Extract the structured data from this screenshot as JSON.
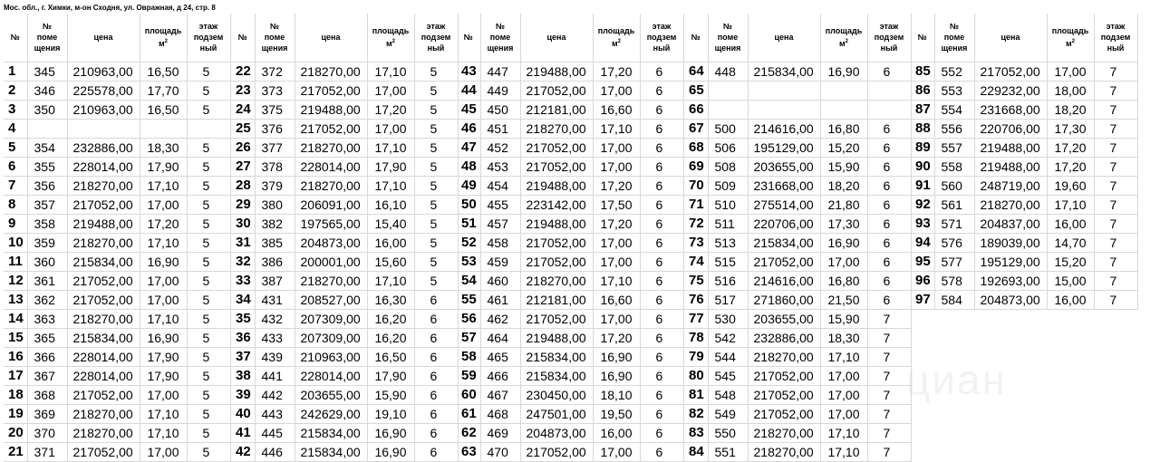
{
  "title": "Мос. обл., г. Химки, м-он Сходня, ул. Овражная, д 24, стр. 8",
  "headers": {
    "num": "№",
    "room_line1": "№",
    "room_line2": "поме",
    "room_line3": "щения",
    "price": "цена",
    "area": "площадь",
    "area_unit": "м",
    "area_sup": "2",
    "floor_line1": "этаж",
    "floor_line2": "подзем",
    "floor_line3": "ный"
  },
  "watermark": "циан",
  "blocks": [
    {
      "rows": [
        [
          "1",
          "345",
          "210963,00",
          "16,50",
          "5"
        ],
        [
          "2",
          "346",
          "225578,00",
          "17,70",
          "5"
        ],
        [
          "3",
          "350",
          "210963,00",
          "16,50",
          "5"
        ],
        [
          "4",
          "",
          "",
          "",
          ""
        ],
        [
          "5",
          "354",
          "232886,00",
          "18,30",
          "5"
        ],
        [
          "6",
          "355",
          "228014,00",
          "17,90",
          "5"
        ],
        [
          "7",
          "356",
          "218270,00",
          "17,10",
          "5"
        ],
        [
          "8",
          "357",
          "217052,00",
          "17,00",
          "5"
        ],
        [
          "9",
          "358",
          "219488,00",
          "17,20",
          "5"
        ],
        [
          "10",
          "359",
          "218270,00",
          "17,10",
          "5"
        ],
        [
          "11",
          "360",
          "215834,00",
          "16,90",
          "5"
        ],
        [
          "12",
          "361",
          "217052,00",
          "17,00",
          "5"
        ],
        [
          "13",
          "362",
          "217052,00",
          "17,00",
          "5"
        ],
        [
          "14",
          "363",
          "218270,00",
          "17,10",
          "5"
        ],
        [
          "15",
          "365",
          "215834,00",
          "16,90",
          "5"
        ],
        [
          "16",
          "366",
          "228014,00",
          "17,90",
          "5"
        ],
        [
          "17",
          "367",
          "228014,00",
          "17,90",
          "5"
        ],
        [
          "18",
          "368",
          "217052,00",
          "17,00",
          "5"
        ],
        [
          "19",
          "369",
          "218270,00",
          "17,10",
          "5"
        ],
        [
          "20",
          "370",
          "218270,00",
          "17,10",
          "5"
        ],
        [
          "21",
          "371",
          "217052,00",
          "17,00",
          "5"
        ]
      ]
    },
    {
      "rows": [
        [
          "22",
          "372",
          "218270,00",
          "17,10",
          "5"
        ],
        [
          "23",
          "373",
          "217052,00",
          "17,00",
          "5"
        ],
        [
          "24",
          "375",
          "219488,00",
          "17,20",
          "5"
        ],
        [
          "25",
          "376",
          "217052,00",
          "17,00",
          "5"
        ],
        [
          "26",
          "377",
          "218270,00",
          "17,10",
          "5"
        ],
        [
          "27",
          "378",
          "228014,00",
          "17,90",
          "5"
        ],
        [
          "28",
          "379",
          "218270,00",
          "17,10",
          "5"
        ],
        [
          "29",
          "380",
          "206091,00",
          "16,10",
          "5"
        ],
        [
          "30",
          "382",
          "197565,00",
          "15,40",
          "5"
        ],
        [
          "31",
          "385",
          "204873,00",
          "16,00",
          "5"
        ],
        [
          "32",
          "386",
          "200001,00",
          "15,60",
          "5"
        ],
        [
          "33",
          "387",
          "218270,00",
          "17,10",
          "5"
        ],
        [
          "34",
          "431",
          "208527,00",
          "16,30",
          "6"
        ],
        [
          "35",
          "432",
          "207309,00",
          "16,20",
          "6"
        ],
        [
          "36",
          "433",
          "207309,00",
          "16,20",
          "6"
        ],
        [
          "37",
          "439",
          "210963,00",
          "16,50",
          "6"
        ],
        [
          "38",
          "441",
          "228014,00",
          "17,90",
          "6"
        ],
        [
          "39",
          "442",
          "203655,00",
          "15,90",
          "6"
        ],
        [
          "40",
          "443",
          "242629,00",
          "19,10",
          "6"
        ],
        [
          "41",
          "445",
          "215834,00",
          "16,90",
          "6"
        ],
        [
          "42",
          "446",
          "215834,00",
          "16,90",
          "6"
        ]
      ]
    },
    {
      "rows": [
        [
          "43",
          "447",
          "219488,00",
          "17,20",
          "6"
        ],
        [
          "44",
          "449",
          "217052,00",
          "17,00",
          "6"
        ],
        [
          "45",
          "450",
          "212181,00",
          "16,60",
          "6"
        ],
        [
          "46",
          "451",
          "218270,00",
          "17,10",
          "6"
        ],
        [
          "47",
          "452",
          "217052,00",
          "17,00",
          "6"
        ],
        [
          "48",
          "453",
          "217052,00",
          "17,00",
          "6"
        ],
        [
          "49",
          "454",
          "219488,00",
          "17,20",
          "6"
        ],
        [
          "50",
          "455",
          "223142,00",
          "17,50",
          "6"
        ],
        [
          "51",
          "457",
          "219488,00",
          "17,20",
          "6"
        ],
        [
          "52",
          "458",
          "217052,00",
          "17,00",
          "6"
        ],
        [
          "53",
          "459",
          "217052,00",
          "17,00",
          "6"
        ],
        [
          "54",
          "460",
          "218270,00",
          "17,10",
          "6"
        ],
        [
          "55",
          "461",
          "212181,00",
          "16,60",
          "6"
        ],
        [
          "56",
          "462",
          "217052,00",
          "17,00",
          "6"
        ],
        [
          "57",
          "464",
          "219488,00",
          "17,20",
          "6"
        ],
        [
          "58",
          "465",
          "215834,00",
          "16,90",
          "6"
        ],
        [
          "59",
          "466",
          "215834,00",
          "16,90",
          "6"
        ],
        [
          "60",
          "467",
          "230450,00",
          "18,10",
          "6"
        ],
        [
          "61",
          "468",
          "247501,00",
          "19,50",
          "6"
        ],
        [
          "62",
          "469",
          "204873,00",
          "16,00",
          "6"
        ],
        [
          "63",
          "470",
          "217052,00",
          "17,00",
          "6"
        ]
      ]
    },
    {
      "rows": [
        [
          "64",
          "448",
          "215834,00",
          "16,90",
          "6"
        ],
        [
          "65",
          "",
          "",
          "",
          ""
        ],
        [
          "66",
          "",
          "",
          "",
          ""
        ],
        [
          "67",
          "500",
          "214616,00",
          "16,80",
          "6"
        ],
        [
          "68",
          "506",
          "195129,00",
          "15,20",
          "6"
        ],
        [
          "69",
          "508",
          "203655,00",
          "15,90",
          "6"
        ],
        [
          "70",
          "509",
          "231668,00",
          "18,20",
          "6"
        ],
        [
          "71",
          "510",
          "275514,00",
          "21,80",
          "6"
        ],
        [
          "72",
          "511",
          "220706,00",
          "17,30",
          "6"
        ],
        [
          "73",
          "513",
          "215834,00",
          "16,90",
          "6"
        ],
        [
          "74",
          "515",
          "217052,00",
          "17,00",
          "6"
        ],
        [
          "75",
          "516",
          "214616,00",
          "16,80",
          "6"
        ],
        [
          "76",
          "517",
          "271860,00",
          "21,50",
          "6"
        ],
        [
          "77",
          "530",
          "203655,00",
          "15,90",
          "7"
        ],
        [
          "78",
          "542",
          "232886,00",
          "18,30",
          "7"
        ],
        [
          "79",
          "544",
          "218270,00",
          "17,10",
          "7"
        ],
        [
          "80",
          "545",
          "217052,00",
          "17,00",
          "7"
        ],
        [
          "81",
          "548",
          "217052,00",
          "17,00",
          "7"
        ],
        [
          "82",
          "549",
          "217052,00",
          "17,00",
          "7"
        ],
        [
          "83",
          "550",
          "218270,00",
          "17,10",
          "7"
        ],
        [
          "84",
          "551",
          "218270,00",
          "17,10",
          "7"
        ]
      ]
    },
    {
      "rows": [
        [
          "85",
          "552",
          "217052,00",
          "17,00",
          "7"
        ],
        [
          "86",
          "553",
          "229232,00",
          "18,00",
          "7"
        ],
        [
          "87",
          "554",
          "231668,00",
          "18,20",
          "7"
        ],
        [
          "88",
          "556",
          "220706,00",
          "17,30",
          "7"
        ],
        [
          "89",
          "557",
          "219488,00",
          "17,20",
          "7"
        ],
        [
          "90",
          "558",
          "219488,00",
          "17,20",
          "7"
        ],
        [
          "91",
          "560",
          "248719,00",
          "19,60",
          "7"
        ],
        [
          "92",
          "561",
          "218270,00",
          "17,10",
          "7"
        ],
        [
          "93",
          "571",
          "204837,00",
          "16,00",
          "7"
        ],
        [
          "94",
          "576",
          "189039,00",
          "14,70",
          "7"
        ],
        [
          "95",
          "577",
          "195129,00",
          "15,20",
          "7"
        ],
        [
          "96",
          "578",
          "192693,00",
          "15,00",
          "7"
        ],
        [
          "97",
          "584",
          "204873,00",
          "16,00",
          "7"
        ]
      ]
    }
  ]
}
